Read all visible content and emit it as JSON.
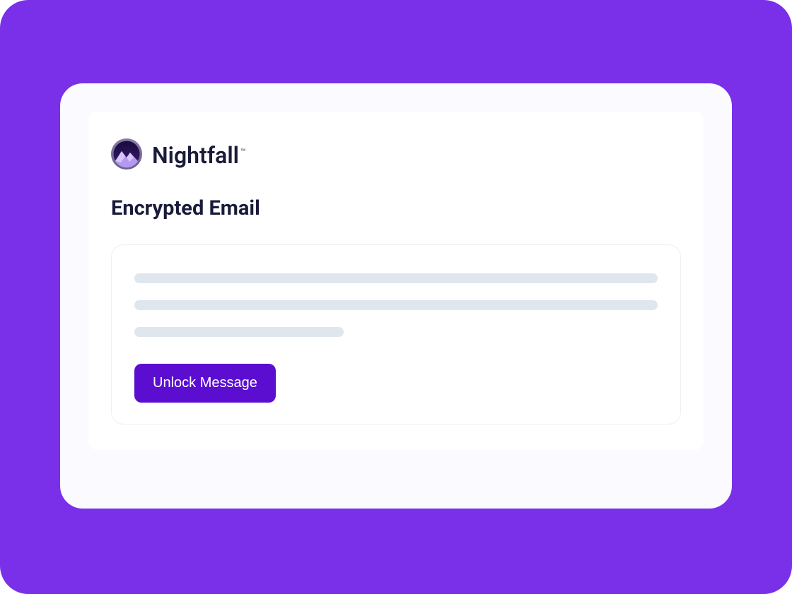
{
  "brand": {
    "name": "Nightfall",
    "trademark": "™"
  },
  "heading": "Encrypted Email",
  "actions": {
    "unlock_label": "Unlock Message"
  },
  "colors": {
    "background": "#7A2FE8",
    "button": "#5B0DD0",
    "text_dark": "#1a1b3a"
  }
}
